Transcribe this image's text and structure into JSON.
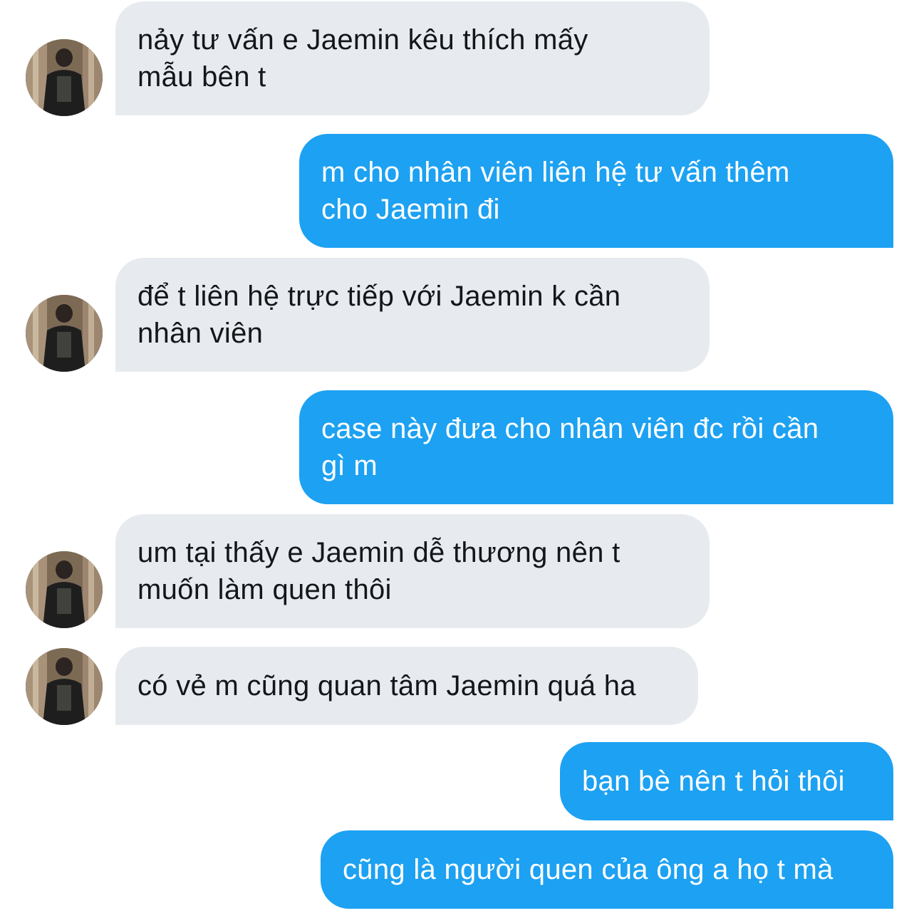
{
  "conversation": {
    "messages": [
      {
        "side": "incoming",
        "text": "nảy tư vấn e Jaemin kêu thích mấy\nmẫu bên t",
        "has_avatar": true
      },
      {
        "side": "outgoing",
        "text": "m cho nhân viên liên hệ tư vấn thêm\ncho Jaemin đi",
        "has_avatar": false
      },
      {
        "side": "incoming",
        "text": "để t liên hệ trực tiếp với Jaemin k cần\nnhân viên",
        "has_avatar": true
      },
      {
        "side": "outgoing",
        "text": "case này đưa cho nhân viên đc rồi cần\ngì m",
        "has_avatar": false
      },
      {
        "side": "incoming",
        "text": "um tại thấy e Jaemin dễ thương nên t\nmuốn làm quen thôi",
        "has_avatar": true
      },
      {
        "side": "incoming",
        "text": "có vẻ m cũng quan tâm Jaemin quá ha",
        "has_avatar": true
      },
      {
        "side": "outgoing",
        "text": "bạn bè nên t hỏi thôi",
        "has_avatar": false
      },
      {
        "side": "outgoing",
        "text": "cũng là người quen của ông a họ t mà",
        "has_avatar": false
      }
    ]
  },
  "colors": {
    "incoming_bubble": "#e7ebef",
    "incoming_text": "#14171a",
    "outgoing_bubble": "#1da1f2",
    "outgoing_text": "#ffffff"
  },
  "avatar_icon": "profile-photo-person-back-view"
}
